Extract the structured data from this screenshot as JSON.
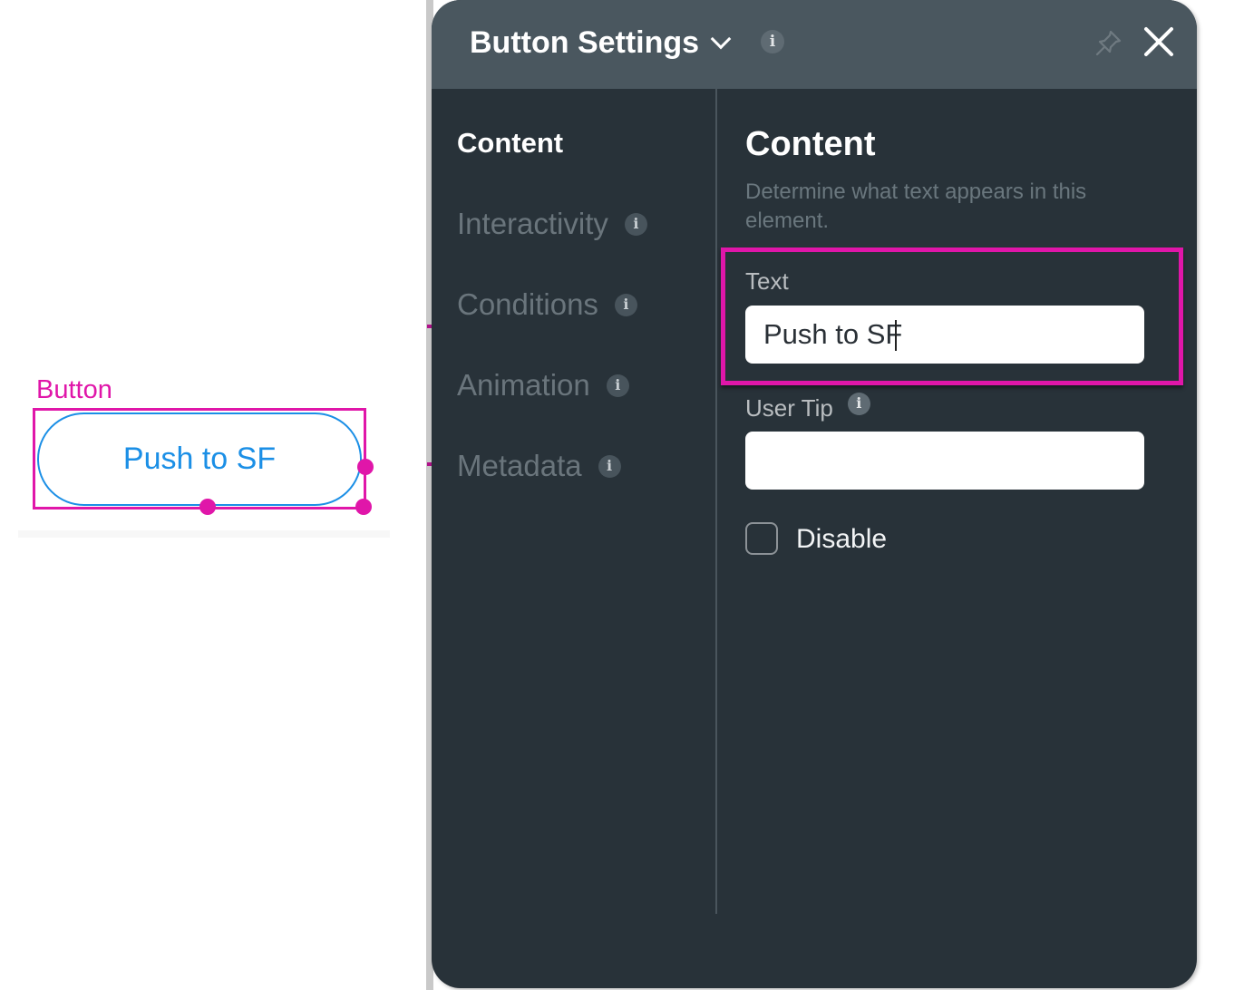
{
  "canvas": {
    "element_tag": "Button",
    "button_label": "Push to SF",
    "colors": {
      "selection": "#e016a9",
      "button_accent": "#1b8fe6"
    }
  },
  "panel": {
    "title": "Button Settings",
    "icons": {
      "title_dropdown": "chevron-down-icon",
      "title_info": "info-icon",
      "pin": "pin-icon",
      "close": "close-icon"
    },
    "nav": [
      {
        "label": "Content",
        "active": true,
        "info": false
      },
      {
        "label": "Interactivity",
        "active": false,
        "info": true
      },
      {
        "label": "Conditions",
        "active": false,
        "info": true
      },
      {
        "label": "Animation",
        "active": false,
        "info": true
      },
      {
        "label": "Metadata",
        "active": false,
        "info": true
      }
    ],
    "content": {
      "title": "Content",
      "description": "Determine what text appears in this element.",
      "text_field": {
        "label": "Text",
        "value": "Push to SF"
      },
      "user_tip_field": {
        "label": "User Tip",
        "value": "",
        "has_info": true
      },
      "disable_checkbox": {
        "label": "Disable",
        "checked": false
      }
    },
    "colors": {
      "header_bg": "#4a575f",
      "body_bg": "#283239",
      "highlight": "#e016a9"
    }
  }
}
